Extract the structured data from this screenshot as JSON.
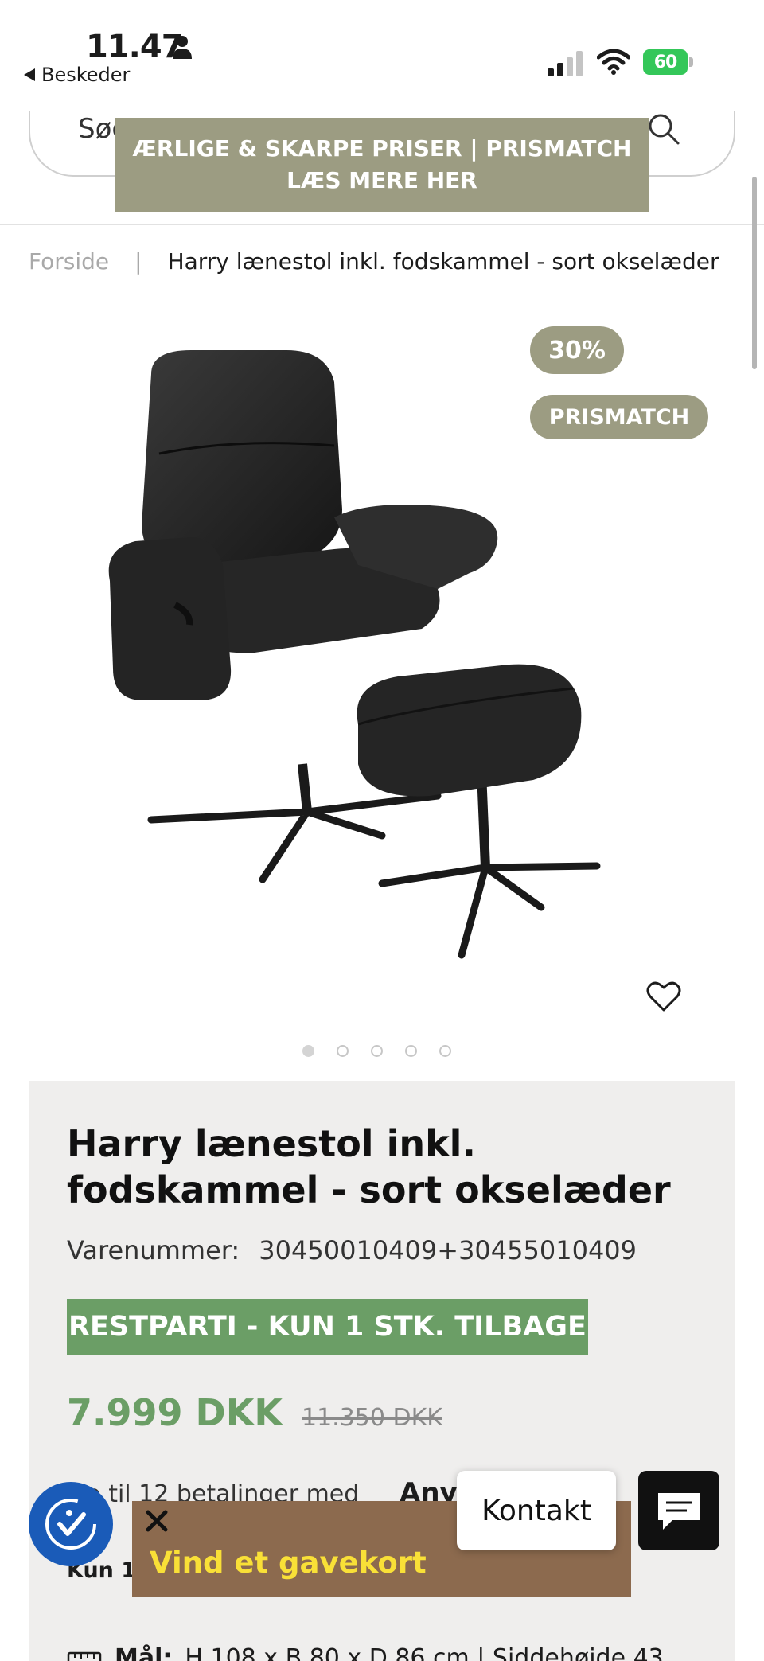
{
  "status_bar": {
    "time": "11.47",
    "back_label": "Beskeder",
    "battery": "60"
  },
  "header": {
    "search_text": "Søg",
    "promo_line1": "ÆRLIGE & SKARPE PRISER | PRISMATCH",
    "promo_line2": "LÆS MERE HER"
  },
  "breadcrumb": {
    "home": "Forside",
    "separator": "|",
    "current": "Harry lænestol inkl. fodskammel - sort okselæder"
  },
  "gallery": {
    "badges": {
      "discount": "30%",
      "prismatch": "PRISMATCH"
    },
    "image_count": 5,
    "active_index": 0
  },
  "product": {
    "title": "Harry lænestol inkl. fodskammel - sort okselæder",
    "sku_label": "Varenummer:",
    "sku": "30450010409+30455010409",
    "stock_badge": "RESTPARTI - KUN 1 STK. TILBAGE",
    "price": "7.999 DKK",
    "old_price": "11.350 DKK",
    "installment_text": "Op til 12 betalinger med",
    "installment_provider": "Anyday",
    "stock_note": "Kun 1.",
    "measure_label": "Mål:",
    "measure_value": "H 108 x B 80 x D 86 cm | Siddehøjde 43"
  },
  "widgets": {
    "gift_text": "Vind et gavekort",
    "contact_label": "Kontakt"
  },
  "colors": {
    "accent_olive": "#9c9c82",
    "accent_green": "#6b9e66",
    "gift_brown": "#8c6a4e",
    "gift_yellow": "#f9e037",
    "accessibility_blue": "#1a5bb8"
  }
}
